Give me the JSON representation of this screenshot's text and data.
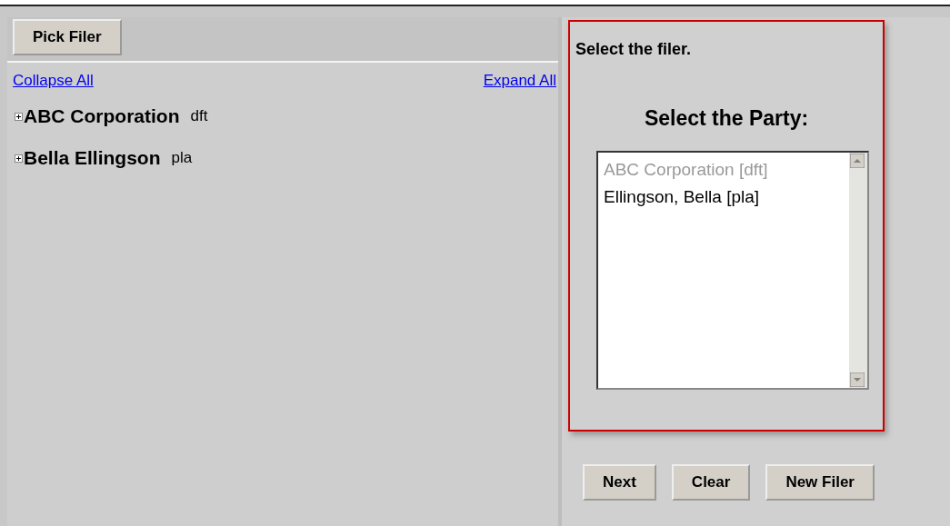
{
  "left_panel": {
    "pick_button": "Pick Filer",
    "collapse_link": "Collapse All",
    "expand_link": "Expand All",
    "tree": [
      {
        "name": "ABC Corporation",
        "role": "dft",
        "expanded": false
      },
      {
        "name": "Bella Ellingson",
        "role": "pla",
        "expanded": false
      }
    ]
  },
  "right_panel": {
    "instruction": "Select the filer.",
    "party_heading": "Select the Party:",
    "parties": [
      {
        "label": "ABC Corporation [dft]",
        "disabled": true
      },
      {
        "label": "Ellingson, Bella [pla]",
        "disabled": false
      }
    ],
    "buttons": [
      "Next",
      "Clear",
      "New Filer"
    ]
  }
}
